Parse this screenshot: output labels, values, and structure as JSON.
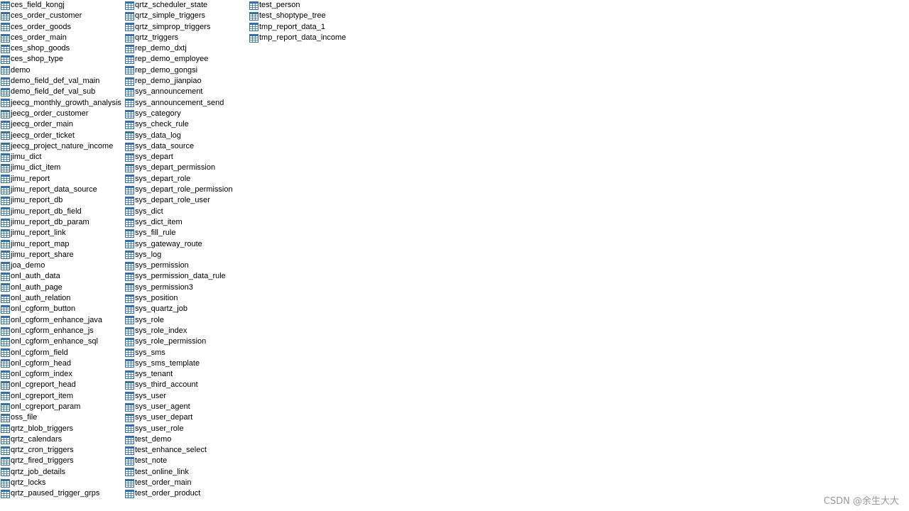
{
  "columns": [
    {
      "items": [
        "ces_field_kongj",
        "ces_order_customer",
        "ces_order_goods",
        "ces_order_main",
        "ces_shop_goods",
        "ces_shop_type",
        "demo",
        "demo_field_def_val_main",
        "demo_field_def_val_sub",
        "jeecg_monthly_growth_analysis",
        "jeecg_order_customer",
        "jeecg_order_main",
        "jeecg_order_ticket",
        "jeecg_project_nature_income",
        "jimu_dict",
        "jimu_dict_item",
        "jimu_report",
        "jimu_report_data_source",
        "jimu_report_db",
        "jimu_report_db_field",
        "jimu_report_db_param",
        "jimu_report_link",
        "jimu_report_map",
        "jimu_report_share",
        "joa_demo",
        "onl_auth_data",
        "onl_auth_page",
        "onl_auth_relation",
        "onl_cgform_button",
        "onl_cgform_enhance_java",
        "onl_cgform_enhance_js",
        "onl_cgform_enhance_sql",
        "onl_cgform_field",
        "onl_cgform_head",
        "onl_cgform_index",
        "onl_cgreport_head",
        "onl_cgreport_item",
        "onl_cgreport_param",
        "oss_file",
        "qrtz_blob_triggers",
        "qrtz_calendars",
        "qrtz_cron_triggers",
        "qrtz_fired_triggers",
        "qrtz_job_details",
        "qrtz_locks",
        "qrtz_paused_trigger_grps"
      ]
    },
    {
      "items": [
        "qrtz_scheduler_state",
        "qrtz_simple_triggers",
        "qrtz_simprop_triggers",
        "qrtz_triggers",
        "rep_demo_dxtj",
        "rep_demo_employee",
        "rep_demo_gongsi",
        "rep_demo_jianpiao",
        "sys_announcement",
        "sys_announcement_send",
        "sys_category",
        "sys_check_rule",
        "sys_data_log",
        "sys_data_source",
        "sys_depart",
        "sys_depart_permission",
        "sys_depart_role",
        "sys_depart_role_permission",
        "sys_depart_role_user",
        "sys_dict",
        "sys_dict_item",
        "sys_fill_rule",
        "sys_gateway_route",
        "sys_log",
        "sys_permission",
        "sys_permission_data_rule",
        "sys_permission3",
        "sys_position",
        "sys_quartz_job",
        "sys_role",
        "sys_role_index",
        "sys_role_permission",
        "sys_sms",
        "sys_sms_template",
        "sys_tenant",
        "sys_third_account",
        "sys_user",
        "sys_user_agent",
        "sys_user_depart",
        "sys_user_role",
        "test_demo",
        "test_enhance_select",
        "test_note",
        "test_online_link",
        "test_order_main",
        "test_order_product"
      ]
    },
    {
      "items": [
        "test_person",
        "test_shoptype_tree",
        "tmp_report_data_1",
        "tmp_report_data_income"
      ]
    }
  ],
  "icon": "table-icon",
  "colors": {
    "icon_stroke": "#2f6fb8",
    "icon_header": "#2f6fb8",
    "icon_fill": "#ffffff",
    "text": "#000000",
    "watermark": "#9a9a9a"
  },
  "watermark": "CSDN @余生大大"
}
